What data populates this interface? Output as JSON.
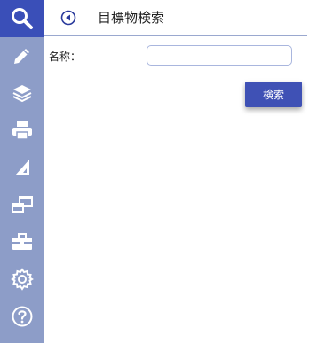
{
  "sidebar": {
    "items": [
      {
        "icon": "search-icon",
        "active": true
      },
      {
        "icon": "pencil-icon"
      },
      {
        "icon": "layers-icon"
      },
      {
        "icon": "printer-icon"
      },
      {
        "icon": "ruler-icon"
      },
      {
        "icon": "windows-icon"
      },
      {
        "icon": "toolbox-icon"
      },
      {
        "icon": "gear-icon"
      },
      {
        "icon": "help-icon"
      }
    ],
    "colors": {
      "background": "#8d9dc8",
      "active": "#3a4fb8"
    }
  },
  "header": {
    "title": "目標物検索"
  },
  "form": {
    "name_label": "名称：",
    "name_value": "",
    "search_label": "検索"
  }
}
